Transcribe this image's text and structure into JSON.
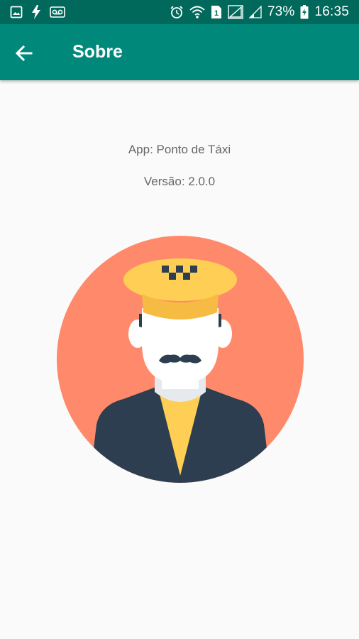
{
  "status_bar": {
    "left_icons": [
      "image-icon",
      "flash-icon",
      "voicemail-icon"
    ],
    "right_icons": [
      "alarm-icon",
      "wifi-icon",
      "sim-icon",
      "signal-icon",
      "signal-weak-icon",
      "battery-charging-icon"
    ],
    "battery": "73%",
    "time": "16:35"
  },
  "app_bar": {
    "back_icon": "arrow-back-icon",
    "title": "Sobre"
  },
  "about": {
    "app_name": "App: Ponto de Táxi",
    "version": "Versão: 2.0.0"
  },
  "illustration": {
    "name": "taxi-driver-avatar",
    "colors": {
      "circle": "#ff8a6b",
      "cap": "#ffce54",
      "cap_brim": "#f6bb42",
      "jacket": "#2c3e50",
      "shirt": "#ffce54",
      "skin": "#ffffff",
      "collar_shadow": "#e6e9ed",
      "hair": "#2c3e50"
    }
  },
  "colors": {
    "status_bar": "#00695c",
    "app_bar": "#00897b",
    "background": "#fafafa",
    "text": "#666666"
  }
}
